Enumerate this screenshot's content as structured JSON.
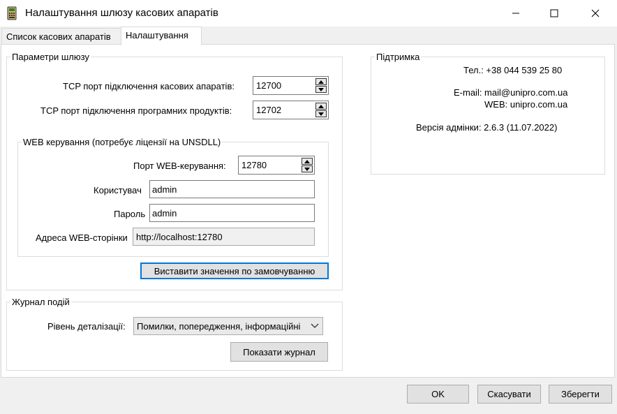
{
  "window": {
    "title": "Налаштування шлюзу касових апаратів"
  },
  "tabs": [
    {
      "label": "Список касових апаратів"
    },
    {
      "label": "Налаштування"
    }
  ],
  "gateway": {
    "legend": "Параметри шлюзу",
    "tcp_devices_label": "TCP порт підключення касових апаратів:",
    "tcp_devices_value": "12700",
    "tcp_software_label": "TCP порт підключення програмних продуктів:",
    "tcp_software_value": "12702",
    "web": {
      "legend": "WEB керування (потребує ліцензії на UNSDLL)",
      "port_label": "Порт WEB-керування:",
      "port_value": "12780",
      "user_label": "Користувач",
      "user_value": "admin",
      "password_label": "Пароль",
      "password_value": "admin",
      "address_label": "Адреса WEB-сторінки",
      "address_value": "http://localhost:12780"
    },
    "defaults_button": "Виставити значення по замовчуванню"
  },
  "log": {
    "legend": "Журнал подій",
    "level_label": "Рівень деталізації:",
    "level_value": "Помилки, попередження, інформаційні",
    "show_button": "Показати журнал"
  },
  "support": {
    "legend": "Підтримка",
    "phone": "Тел.: +38 044 539 25 80",
    "email": "E-mail: mail@unipro.com.ua",
    "web": "WEB: unipro.com.ua",
    "version": "Версія адмінки: 2.6.3  (11.07.2022)"
  },
  "footer": {
    "ok": "OK",
    "cancel": "Скасувати",
    "save": "Зберегти"
  }
}
